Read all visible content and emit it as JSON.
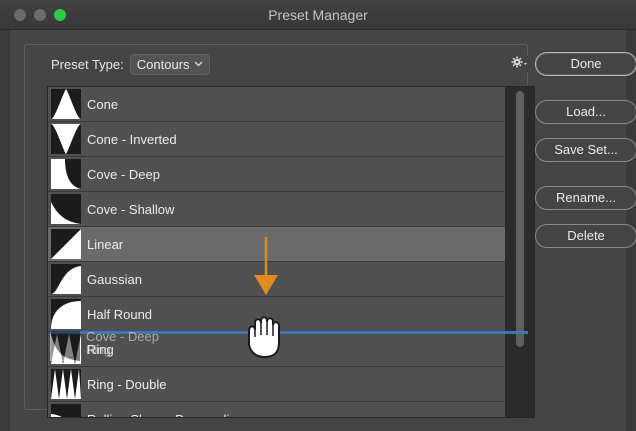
{
  "window": {
    "title": "Preset Manager"
  },
  "preset_type": {
    "label": "Preset Type:",
    "value": "Contours"
  },
  "gear_icon": "gear-icon",
  "presets": [
    {
      "label": "Cone",
      "shape": "cone",
      "selected": false
    },
    {
      "label": "Cone - Inverted",
      "shape": "cone-inverted",
      "selected": false
    },
    {
      "label": "Cove - Deep",
      "shape": "cove-deep",
      "selected": false
    },
    {
      "label": "Cove - Shallow",
      "shape": "cove-shallow",
      "selected": false
    },
    {
      "label": "Linear",
      "shape": "linear",
      "selected": true
    },
    {
      "label": "Gaussian",
      "shape": "gaussian",
      "selected": false
    },
    {
      "label": "Half Round",
      "shape": "half-round",
      "selected": false
    },
    {
      "label": "Ring",
      "shape": "ring",
      "selected": false
    },
    {
      "label": "Ring - Double",
      "shape": "ring-double",
      "selected": false
    },
    {
      "label": "Rolling Slope - Descending",
      "shape": "rolling-slope",
      "selected": false
    }
  ],
  "drag": {
    "label": "Cove - Deep"
  },
  "buttons": {
    "done": "Done",
    "load": "Load...",
    "save_set": "Save Set...",
    "rename": "Rename...",
    "delete": "Delete"
  },
  "colors": {
    "drop_indicator": "#3e7ac9",
    "drag_arrow": "#e08a23",
    "selected_row": "#6a6a6a",
    "maximize_button": "#2dcb45"
  }
}
